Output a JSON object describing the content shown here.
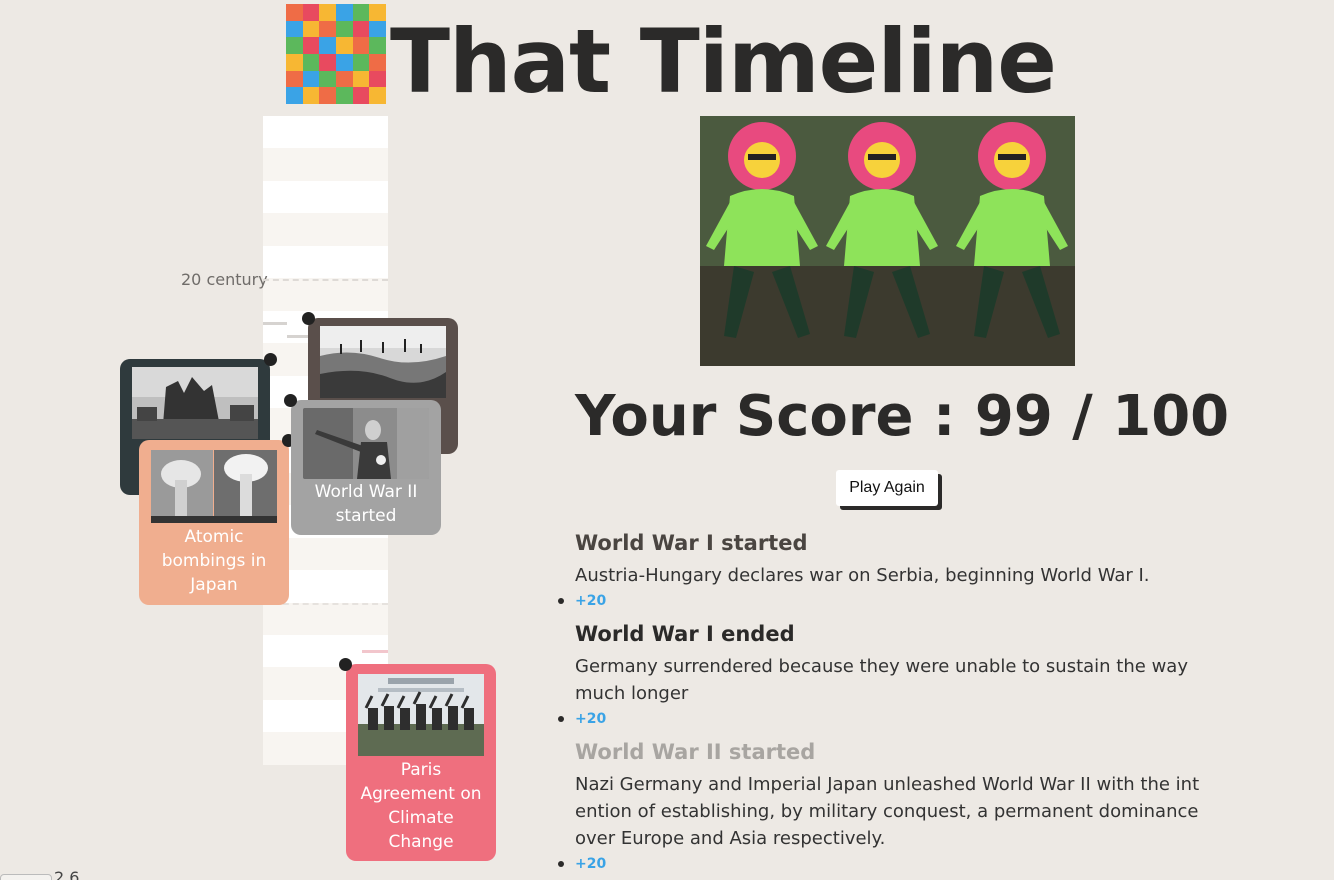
{
  "app": {
    "title": "That Timeline",
    "logo_colors": [
      "#ef6c46",
      "#e84a5f",
      "#f7b733",
      "#3aa3e6",
      "#5cb85c",
      "#f7b733",
      "#3aa3e6",
      "#f7b733",
      "#ef6c46",
      "#5cb85c",
      "#e84a5f",
      "#3aa3e6",
      "#5cb85c",
      "#e84a5f",
      "#3aa3e6",
      "#f7b733",
      "#ef6c46",
      "#5cb85c",
      "#f7b733",
      "#5cb85c",
      "#e84a5f",
      "#3aa3e6",
      "#5cb85c",
      "#ef6c46",
      "#ef6c46",
      "#3aa3e6",
      "#5cb85c",
      "#ef6c46",
      "#f7b733",
      "#e84a5f",
      "#3aa3e6",
      "#f7b733",
      "#ef6c46",
      "#5cb85c",
      "#e84a5f",
      "#f7b733"
    ]
  },
  "timeline": {
    "century_label": "20 century",
    "cards": [
      {
        "id": "ww1-ended",
        "label": "",
        "color": "#5a4f4b",
        "image": "battlefield-photo"
      },
      {
        "id": "ww1-started",
        "label": "",
        "color": "#2f3a3d",
        "image": "city-ruins-photo"
      },
      {
        "id": "ww2-started",
        "label": "World War II started",
        "color": "#a3a3a3",
        "image": "dictator-salute-photo"
      },
      {
        "id": "atomic",
        "label": "Atomic bombings in Japan",
        "color": "#f0ae8f",
        "image": "mushroom-cloud-photo"
      },
      {
        "id": "paris",
        "label": "Paris Agreement on Climate Change",
        "color": "#ef6f7e",
        "image": "climate-conference-photo"
      }
    ]
  },
  "result_panel": {
    "image": "dancing-flower-gif",
    "score_text": "Your Score : 99 / 100",
    "play_again_label": "Play Again",
    "items": [
      {
        "title": "World War I started",
        "description": "Austria-Hungary declares war on Serbia, beginning World War I.",
        "points": "+20",
        "title_color": "#4a4541"
      },
      {
        "title": "World War I ended",
        "description": "Germany surrendered because they were unable to sustain the way much longer",
        "points": "+20",
        "title_color": "#2b2a29"
      },
      {
        "title": "World War II started",
        "description": "Nazi Germany and Imperial Japan unleashed World War II with the intention of establishing, by military conquest, a permanent dominance over Europe and Asia respectively.",
        "points": "+20",
        "title_color": "#a8a5a1"
      }
    ]
  },
  "footer": {
    "version": "2.6"
  }
}
